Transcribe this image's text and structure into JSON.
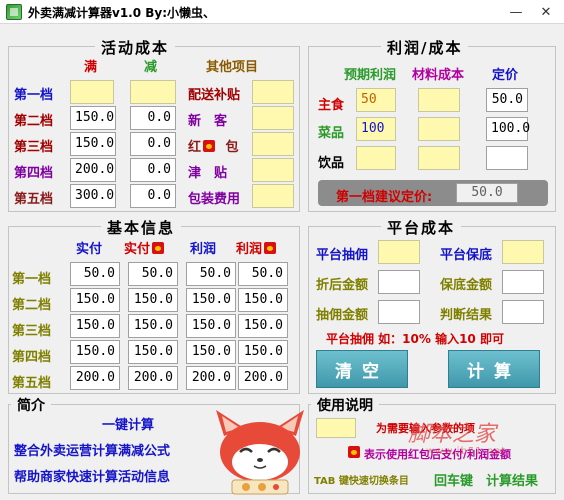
{
  "window": {
    "title": "外卖满减计算器v1.0    By:小懒虫、",
    "minimize": "—",
    "close": "✕"
  },
  "activity": {
    "title": "活动成本",
    "col_full": "满",
    "col_reduce": "减",
    "col_other": "其他项目",
    "tiers": [
      {
        "label": "第一档",
        "full": "",
        "reduce": ""
      },
      {
        "label": "第二档",
        "full": "150.0",
        "reduce": "0.0"
      },
      {
        "label": "第三档",
        "full": "150.0",
        "reduce": "0.0"
      },
      {
        "label": "第四档",
        "full": "200.0",
        "reduce": "0.0"
      },
      {
        "label": "第五档",
        "full": "300.0",
        "reduce": "0.0"
      }
    ],
    "others": [
      {
        "label": "配送补贴",
        "value": ""
      },
      {
        "label": "新　客",
        "value": ""
      },
      {
        "label": "红",
        "label2": "包",
        "value": ""
      },
      {
        "label": "津　贴",
        "value": ""
      },
      {
        "label": "包装费用",
        "value": ""
      }
    ]
  },
  "profit": {
    "title": "利润/成本",
    "col_expected": "预期利润",
    "col_material": "材料成本",
    "col_price": "定价",
    "rows": [
      {
        "label": "主食",
        "expected": "50",
        "material": "",
        "price": "50.0"
      },
      {
        "label": "菜品",
        "expected": "100",
        "material": "",
        "price": "100.0"
      },
      {
        "label": "饮品",
        "expected": "",
        "material": "",
        "price": ""
      }
    ],
    "suggest_label": "第一档建议定价:",
    "suggest_value": "50.0"
  },
  "basic": {
    "title": "基本信息",
    "col_paid": "实付",
    "col_paid2": "实付",
    "col_profit": "利润",
    "col_profit2": "利润",
    "rows": [
      {
        "label": "第一档",
        "v": [
          "50.0",
          "50.0",
          "50.0",
          "50.0"
        ]
      },
      {
        "label": "第二档",
        "v": [
          "150.0",
          "150.0",
          "150.0",
          "150.0"
        ]
      },
      {
        "label": "第三档",
        "v": [
          "150.0",
          "150.0",
          "150.0",
          "150.0"
        ]
      },
      {
        "label": "第四档",
        "v": [
          "150.0",
          "150.0",
          "150.0",
          "150.0"
        ]
      },
      {
        "label": "第五档",
        "v": [
          "200.0",
          "200.0",
          "200.0",
          "200.0"
        ]
      }
    ]
  },
  "platform": {
    "title": "平台成本",
    "commission": "平台抽佣",
    "guarantee": "平台保底",
    "discounted": "折后金额",
    "guarantee_amount": "保底金额",
    "commission_amount": "抽佣金额",
    "judgement": "判断结果",
    "hint": "平台抽佣 如：10% 输入10 即可",
    "clear_btn": "清空",
    "calc_btn": "计算"
  },
  "intro": {
    "title": "简介",
    "line1": "一键计算",
    "line2": "整合外卖运营计算满减公式",
    "line3": "帮助商家快速计算活动信息"
  },
  "usage": {
    "title": "使用说明",
    "line1": "为需要输入参数的项",
    "line2": "表示使用红包后支付/利润金额",
    "line3_a": "TAB 键快速切换条目",
    "line3_b": "回车键",
    "line3_c": "计算结果"
  },
  "watermark": {
    "main": "脚本之家",
    "sub": "www.jb51.net"
  },
  "colors": {
    "input_yellow": "#fff9b0",
    "button_teal": "#4aa7b9",
    "accent_red": "#d00000",
    "accent_blue": "#1414c8"
  }
}
